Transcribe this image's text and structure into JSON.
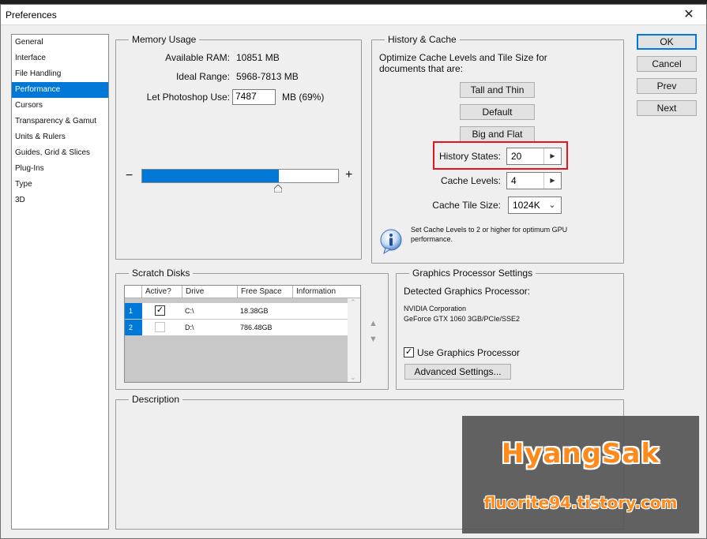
{
  "window": {
    "title": "Preferences",
    "close_glyph": "✕"
  },
  "sidebar": {
    "items": [
      {
        "label": "General"
      },
      {
        "label": "Interface"
      },
      {
        "label": "File Handling"
      },
      {
        "label": "Performance",
        "selected": true
      },
      {
        "label": "Cursors"
      },
      {
        "label": "Transparency & Gamut"
      },
      {
        "label": "Units & Rulers"
      },
      {
        "label": "Guides, Grid & Slices"
      },
      {
        "label": "Plug-Ins"
      },
      {
        "label": "Type"
      },
      {
        "label": "3D"
      }
    ]
  },
  "memory": {
    "title": "Memory Usage",
    "available_label": "Available RAM:",
    "available_value": "10851 MB",
    "ideal_label": "Ideal Range:",
    "ideal_value": "5968-7813 MB",
    "let_label": "Let Photoshop Use:",
    "let_value": "7487",
    "let_suffix": "MB (69%)",
    "minus": "−",
    "plus": "+",
    "slider_percent": 69
  },
  "history_cache": {
    "title": "History & Cache",
    "desc": "Optimize Cache Levels and Tile Size for documents that are:",
    "btn_tall": "Tall and Thin",
    "btn_default": "Default",
    "btn_big": "Big and Flat",
    "history_label": "History States:",
    "history_value": "20",
    "cache_levels_label": "Cache Levels:",
    "cache_levels_value": "4",
    "tile_label": "Cache Tile Size:",
    "tile_value": "1024K",
    "info_text": "Set Cache Levels to 2 or higher for optimum GPU performance.",
    "highlight_color": "#e8141b"
  },
  "scratch": {
    "title": "Scratch Disks",
    "headers": [
      "Active?",
      "Drive",
      "Free Space",
      "Information"
    ],
    "rows": [
      {
        "index": "1",
        "active": true,
        "drive": "C:\\",
        "free": "18.38GB",
        "info": ""
      },
      {
        "index": "2",
        "active": false,
        "drive": "D:\\",
        "free": "786.48GB",
        "info": ""
      }
    ]
  },
  "gpu": {
    "title": "Graphics Processor Settings",
    "detected_label": "Detected Graphics Processor:",
    "vendor": "NVIDIA Corporation",
    "model": "GeForce GTX 1060 3GB/PCIe/SSE2",
    "use_label": "Use Graphics Processor",
    "use_checked": true,
    "advanced_label": "Advanced Settings..."
  },
  "description": {
    "title": "Description"
  },
  "buttons": {
    "ok": "OK",
    "cancel": "Cancel",
    "prev": "Prev",
    "next": "Next"
  },
  "watermark": {
    "title": "HyangSak",
    "subtitle": "fluorite94.tistory.com"
  },
  "colors": {
    "accent": "#0078d7",
    "dialog_bg": "#efefef"
  }
}
